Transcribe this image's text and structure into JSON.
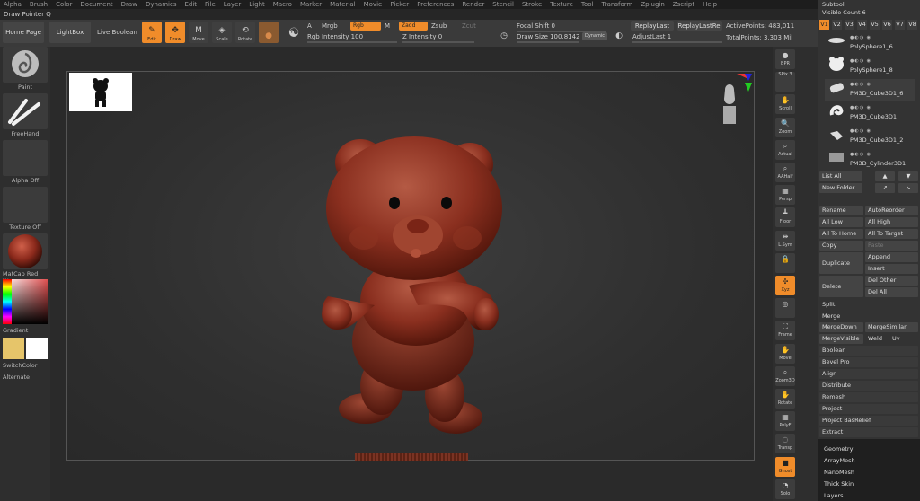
{
  "menu": [
    "Alpha",
    "Brush",
    "Color",
    "Document",
    "Draw",
    "Dynamics",
    "Edit",
    "File",
    "Layer",
    "Light",
    "Macro",
    "Marker",
    "Material",
    "Movie",
    "Picker",
    "Preferences",
    "Render",
    "Stencil",
    "Stroke",
    "Texture",
    "Tool",
    "Transform",
    "Zplugin",
    "Zscript",
    "Help"
  ],
  "title": "Draw Pointer Q",
  "top": {
    "home_page": "Home Page",
    "lightbox": "LightBox",
    "live_boolean": "Live Boolean",
    "tools": [
      {
        "label": "Edit",
        "icon": "✎",
        "on": true
      },
      {
        "label": "Draw",
        "icon": "✥",
        "on": true
      },
      {
        "label": "Move",
        "icon": "M",
        "on": false
      },
      {
        "label": "Scale",
        "icon": "◈",
        "on": false
      },
      {
        "label": "Rotate",
        "icon": "⟲",
        "on": false
      }
    ],
    "a_label": "A",
    "mrgb": "Mrgb",
    "rgb": "Rgb",
    "m_label": "M",
    "zadd": "Zadd",
    "zsub": "Zsub",
    "zcut": "Zcut",
    "rgb_intensity": "Rgb Intensity 100",
    "z_intensity": "Z Intensity 0",
    "focal_shift": "Focal Shift 0",
    "draw_size": "Draw Size 100.8142",
    "dynamic": "Dynamic",
    "replay_last": "ReplayLast",
    "replay_last_rel": "ReplayLastRel",
    "adjust_last": "AdjustLast 1",
    "active_points": "ActivePoints: 483,011",
    "total_points": "TotalPoints: 3.303 Mil"
  },
  "left": {
    "brush": "Paint",
    "stroke": "FreeHand",
    "alpha": "Alpha Off",
    "texture": "Texture Off",
    "material": "MatCap Red Wa",
    "gradient": "Gradient",
    "switch_color": "SwitchColor",
    "alternate": "Alternate",
    "colors": {
      "primary": "#e6c56a",
      "secondary": "#ffffff",
      "material": "#9a2f20"
    }
  },
  "shelf": [
    {
      "label": "BPR",
      "icon": "●"
    },
    {
      "label": "SPix 3",
      "icon": ""
    },
    {
      "label": "Scroll",
      "icon": "✋"
    },
    {
      "label": "Zoom",
      "icon": "🔍"
    },
    {
      "label": "Actual",
      "icon": "⌕"
    },
    {
      "label": "AAHalf",
      "icon": "⌕"
    },
    {
      "label": "Persp",
      "icon": "▦"
    },
    {
      "label": "Floor",
      "icon": "┻"
    },
    {
      "label": "L.Sym",
      "icon": "⇹"
    },
    {
      "label": "",
      "icon": "🔒"
    },
    {
      "label": "Xyz",
      "icon": "✣",
      "on": true
    },
    {
      "label": "",
      "icon": "◎"
    },
    {
      "label": "Frame",
      "icon": "⛶"
    },
    {
      "label": "Move",
      "icon": "✋"
    },
    {
      "label": "Zoom3D",
      "icon": "⌕"
    },
    {
      "label": "Rotate",
      "icon": "✋"
    },
    {
      "label": "PolyF",
      "icon": "▦"
    },
    {
      "label": "Transp",
      "icon": "◌"
    },
    {
      "label": "Ghost",
      "icon": "■",
      "on": true
    },
    {
      "label": "Solo",
      "icon": "◔"
    }
  ],
  "subtool": {
    "header": "Subtool",
    "visible_count": "Visible Count 6",
    "versions": [
      "V1",
      "V2",
      "V3",
      "V4",
      "V5",
      "V6",
      "V7",
      "V8"
    ],
    "items": [
      {
        "name": "PolySphere1_6"
      },
      {
        "name": "PolySphere1_8"
      },
      {
        "name": "PM3D_Cube3D1_6"
      },
      {
        "name": "PM3D_Cube3D1"
      },
      {
        "name": "PM3D_Cube3D1_2"
      },
      {
        "name": "PM3D_Cylinder3D1"
      }
    ],
    "list_all": "List All",
    "new_folder": "New Folder",
    "rename": "Rename",
    "auto_reorder": "AutoReorder",
    "all_low": "All Low",
    "all_high": "All High",
    "all_to_home": "All To Home",
    "all_to_target": "All To Target",
    "copy": "Copy",
    "paste": "Paste",
    "append": "Append",
    "duplicate": "Duplicate",
    "insert": "Insert",
    "delete": "Delete",
    "del_other": "Del Other",
    "del_all": "Del All",
    "split": "Split",
    "merge": "Merge",
    "merge_down": "MergeDown",
    "merge_similar": "MergeSimilar",
    "merge_visible": "MergeVisible",
    "weld": "Weld",
    "uv": "Uv",
    "boolean": "Boolean",
    "bevel_pro": "Bevel Pro",
    "align": "Align",
    "distribute": "Distribute",
    "remesh": "Remesh",
    "project": "Project",
    "project_basrelief": "Project BasRelief",
    "extract": "Extract",
    "sections": [
      "Geometry",
      "ArrayMesh",
      "NanoMesh",
      "Thick Skin",
      "Layers"
    ]
  }
}
